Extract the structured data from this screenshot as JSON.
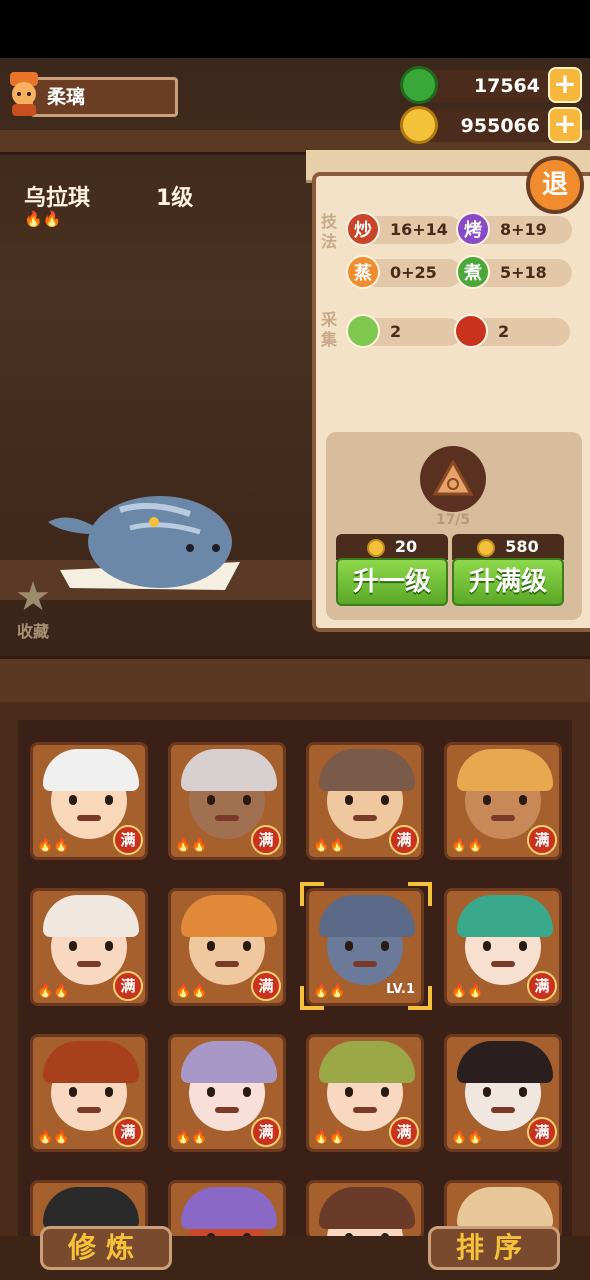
{
  "player": {
    "name": "柔璃"
  },
  "currency": {
    "jade": "17564",
    "coins": "955066",
    "plus": "+"
  },
  "character": {
    "name": "乌拉琪",
    "level": "1级",
    "flames": "🔥🔥"
  },
  "favorite": {
    "label": "收藏",
    "icon": "star-icon"
  },
  "panel": {
    "retreat": "退",
    "skills_label": "技法",
    "gather_label": "采集",
    "skills": [
      {
        "badge": "炒",
        "value": "16+14",
        "color": "#c8452a"
      },
      {
        "badge": "烤",
        "value": "8+19",
        "color": "#8a4ac8"
      },
      {
        "badge": "蒸",
        "value": "0+25",
        "color": "#f08c2d"
      },
      {
        "badge": "煮",
        "value": "5+18",
        "color": "#4aa838"
      }
    ],
    "gather": [
      {
        "icon": "cabbage-icon",
        "value": "2"
      },
      {
        "icon": "meat-icon",
        "value": "2"
      }
    ],
    "item_progress": "17/5",
    "upgrade_one": {
      "cost": "20",
      "label": "升一级"
    },
    "upgrade_max": {
      "cost": "580",
      "label": "升满级"
    }
  },
  "roster": {
    "full_label": "满",
    "selected_level": "LV.1",
    "cards": [
      {
        "hat": "#f0f0f0",
        "face": "#f8d8b8",
        "tag": "full"
      },
      {
        "hat": "#d8d0d0",
        "face": "#a07050",
        "tag": "full"
      },
      {
        "hat": "#7a5a48",
        "face": "#f0c8a0",
        "tag": "full"
      },
      {
        "hat": "#e8a850",
        "face": "#c88858",
        "tag": "full"
      },
      {
        "hat": "#f0e8e0",
        "face": "#f8d8c0",
        "tag": "full"
      },
      {
        "hat": "#e08a3a",
        "face": "#f0c8a0",
        "tag": "full"
      },
      {
        "hat": "#5a6a88",
        "face": "#6a7a98",
        "tag": "level"
      },
      {
        "hat": "#3aa88a",
        "face": "#f8e0d0",
        "tag": "full"
      },
      {
        "hat": "#a8401e",
        "face": "#f8d8c0",
        "tag": "full"
      },
      {
        "hat": "#a898c8",
        "face": "#f8e0d8",
        "tag": "full"
      },
      {
        "hat": "#9aa848",
        "face": "#f8d8c0",
        "tag": "full"
      },
      {
        "hat": "#2a1e1e",
        "face": "#f0e8e0",
        "tag": "full"
      },
      {
        "hat": "#2a2a2a",
        "face": "#f8d8c0",
        "tag": "none"
      },
      {
        "hat": "#8a68c8",
        "face": "#c84a2a",
        "tag": "none"
      },
      {
        "hat": "#6a3a2a",
        "face": "#f8d8c0",
        "tag": "none"
      },
      {
        "hat": "#e8c898",
        "face": "#f0e0c8",
        "tag": "none"
      }
    ]
  },
  "footer": {
    "cultivate": "修炼",
    "sort": "排序"
  }
}
